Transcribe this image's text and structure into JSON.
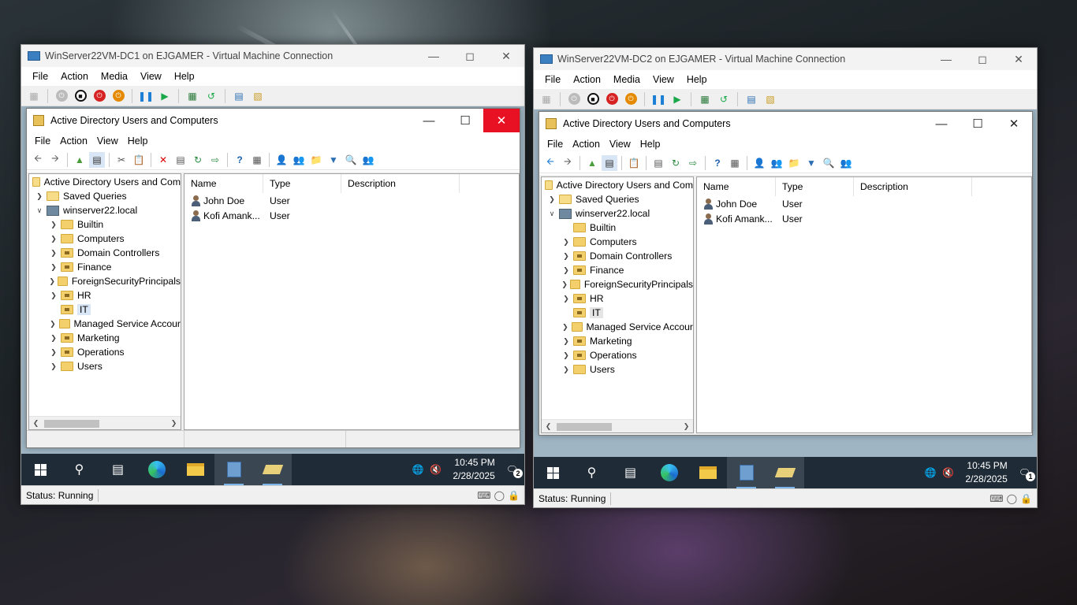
{
  "windows": [
    {
      "title": "WinServer22VM-DC1 on EJGAMER - Virtual Machine Connection",
      "active_close_highlight": true,
      "tray_badge": "2"
    },
    {
      "title": "WinServer22VM-DC2 on EJGAMER - Virtual Machine Connection",
      "active_close_highlight": false,
      "tray_badge": "1"
    }
  ],
  "vm_menu": [
    "File",
    "Action",
    "Media",
    "View",
    "Help"
  ],
  "aduc": {
    "title": "Active Directory Users and Computers",
    "menu": [
      "File",
      "Action",
      "View",
      "Help"
    ],
    "tree": {
      "root": "Active Directory Users and Com",
      "saved_queries": "Saved Queries",
      "domain": "winserver22.local",
      "children": [
        "Builtin",
        "Computers",
        "Domain Controllers",
        "Finance",
        "ForeignSecurityPrincipals",
        "HR",
        "IT",
        "Managed Service Accour",
        "Marketing",
        "Operations",
        "Users"
      ],
      "selected": "IT"
    },
    "columns": [
      "Name",
      "Type",
      "Description"
    ],
    "rows": [
      {
        "name": "John Doe",
        "type": "User",
        "description": ""
      },
      {
        "name": "Kofi Amank...",
        "type": "User",
        "description": ""
      }
    ]
  },
  "taskbar": {
    "time": "10:45 PM",
    "date": "2/28/2025"
  },
  "status": "Status: Running",
  "colors": {
    "close_red": "#e81123",
    "taskbar": "#1f2b36"
  }
}
